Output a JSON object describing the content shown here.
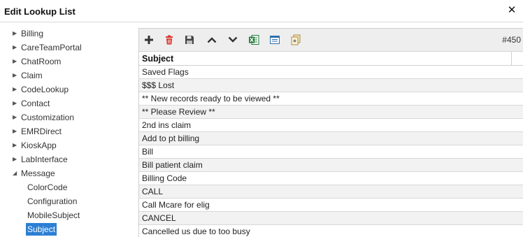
{
  "window": {
    "title": "Edit Lookup List",
    "close_glyph": "✕"
  },
  "tree": {
    "items": [
      {
        "label": "Billing",
        "expanded": false
      },
      {
        "label": "CareTeamPortal",
        "expanded": false
      },
      {
        "label": "ChatRoom",
        "expanded": false
      },
      {
        "label": "Claim",
        "expanded": false
      },
      {
        "label": "CodeLookup",
        "expanded": false
      },
      {
        "label": "Contact",
        "expanded": false
      },
      {
        "label": "Customization",
        "expanded": false
      },
      {
        "label": "EMRDirect",
        "expanded": false
      },
      {
        "label": "KioskApp",
        "expanded": false
      },
      {
        "label": "LabInterface",
        "expanded": false
      },
      {
        "label": "Message",
        "expanded": true
      },
      {
        "label": "ColorCode",
        "child": true
      },
      {
        "label": "Configuration",
        "child": true
      },
      {
        "label": "MobileSubject",
        "child": true
      },
      {
        "label": "Subject",
        "child": true,
        "selected": true
      }
    ],
    "collapsed_arrow": "▶",
    "expanded_arrow": "◢",
    "selected_color": "#2b7fd4"
  },
  "toolbar": {
    "buttons": [
      {
        "name": "add-button",
        "icon": "plus-icon"
      },
      {
        "name": "delete-button",
        "icon": "trash-icon"
      },
      {
        "name": "save-button",
        "icon": "save-icon"
      },
      {
        "name": "move-up-button",
        "icon": "chevron-up-icon"
      },
      {
        "name": "move-down-button",
        "icon": "chevron-down-icon"
      },
      {
        "name": "export-excel-button",
        "icon": "excel-icon"
      },
      {
        "name": "import-button",
        "icon": "import-icon"
      },
      {
        "name": "copy-button",
        "icon": "copy-icon"
      }
    ],
    "record_count": "#450"
  },
  "grid": {
    "column_header": "Subject",
    "rows": [
      "Saved Flags",
      "$$$ Lost",
      "** New records ready to be viewed **",
      "** Please Review **",
      "2nd ins claim",
      "Add to pt billing",
      "Bill",
      "Bill patient claim",
      "Billing Code",
      "CALL",
      "Call Mcare for elig",
      "CANCEL",
      "Cancelled us due to too busy"
    ]
  },
  "colors": {
    "delete_red": "#d9342b",
    "excel_green": "#1e7a3a",
    "toolbar_bg": "#eeeeee",
    "alt_row_bg": "#f2f2f2"
  }
}
